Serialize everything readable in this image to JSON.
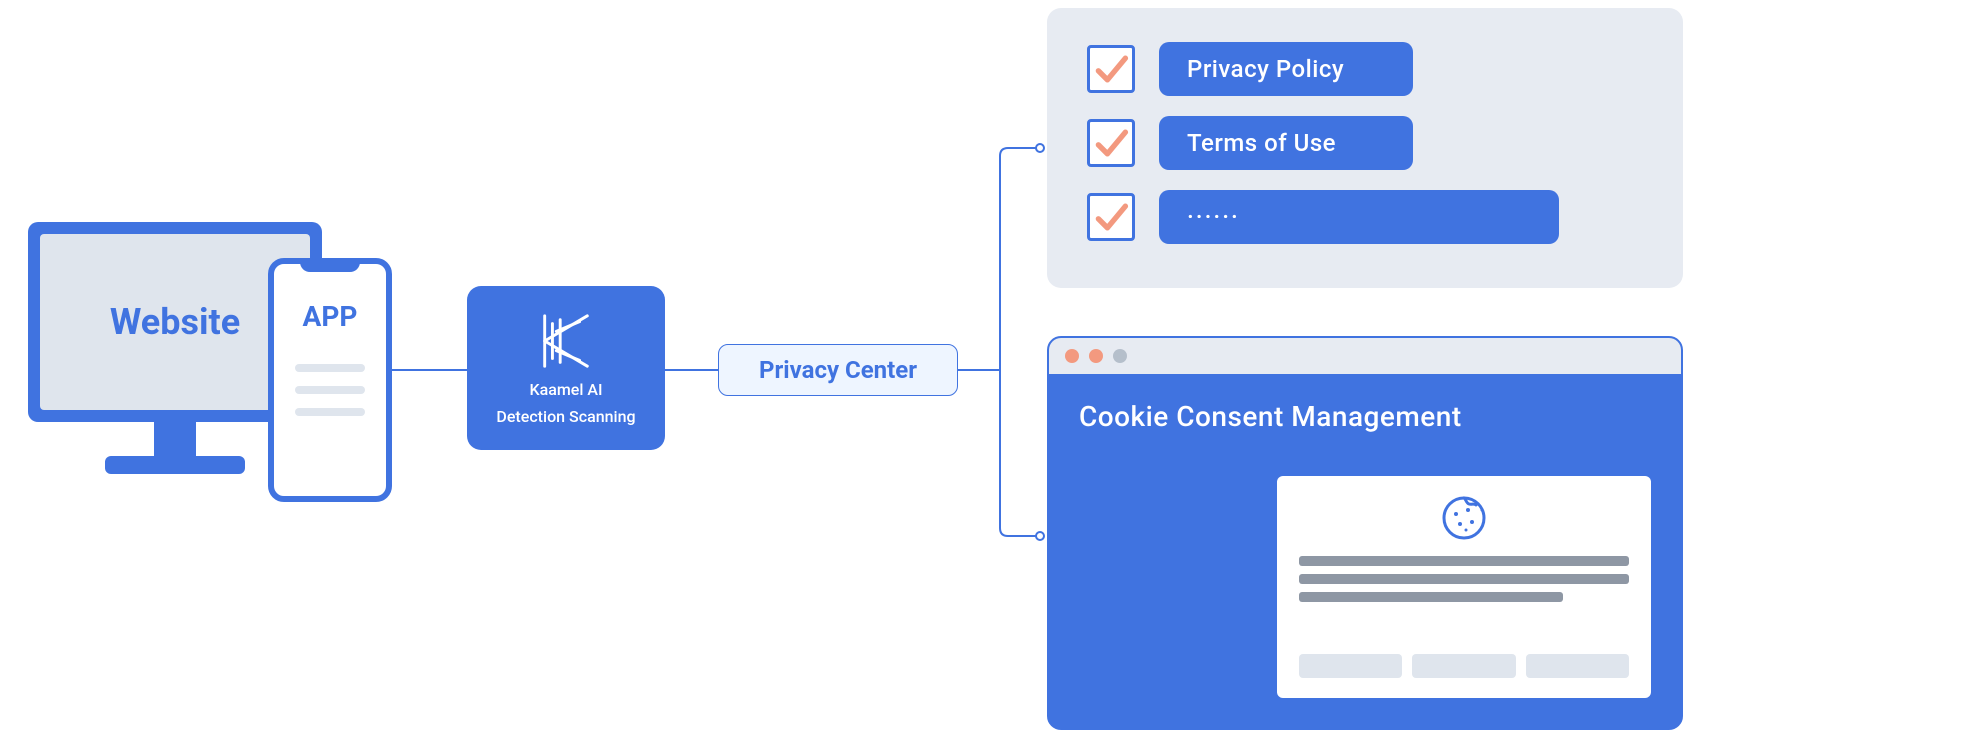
{
  "left": {
    "website_label": "Website",
    "app_label": "APP"
  },
  "ai_card": {
    "line1": "Kaamel AI",
    "line2": "Detection Scanning"
  },
  "privacy_center_label": "Privacy Center",
  "policy_panel": {
    "items": [
      {
        "label": "Privacy Policy"
      },
      {
        "label": "Terms of Use"
      },
      {
        "label": "······"
      }
    ]
  },
  "cookie_window": {
    "title": "Cookie Consent Management"
  },
  "colors": {
    "primary": "#4073e0",
    "panel_bg": "#e7ebf2",
    "coral": "#f3997f",
    "grey": "#b5bfcb"
  }
}
